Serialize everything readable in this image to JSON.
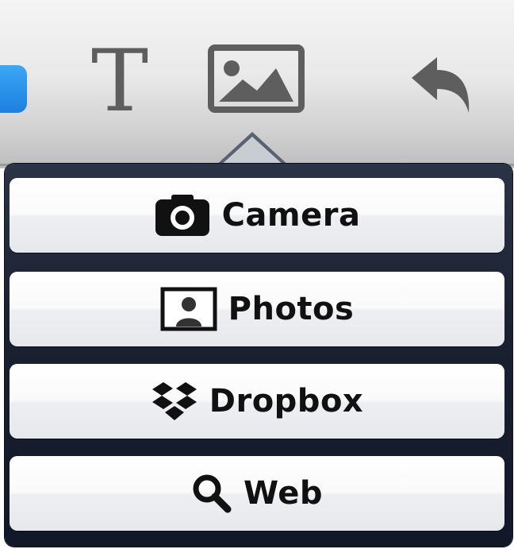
{
  "toolbar": {
    "text_tool_glyph": "T",
    "icons": [
      "blue-shape-icon",
      "text-icon",
      "image-icon",
      "undo-icon"
    ]
  },
  "popover": {
    "items": [
      {
        "label": "Camera",
        "icon": "camera-icon"
      },
      {
        "label": "Photos",
        "icon": "photos-icon"
      },
      {
        "label": "Dropbox",
        "icon": "dropbox-icon"
      },
      {
        "label": "Web",
        "icon": "search-icon"
      }
    ]
  },
  "colors": {
    "popover_background": "#1a2131",
    "item_background": "#f5f5f7",
    "accent_blue": "#1e7fe0",
    "toolbar_icon_gray": "#5e5e5e"
  }
}
